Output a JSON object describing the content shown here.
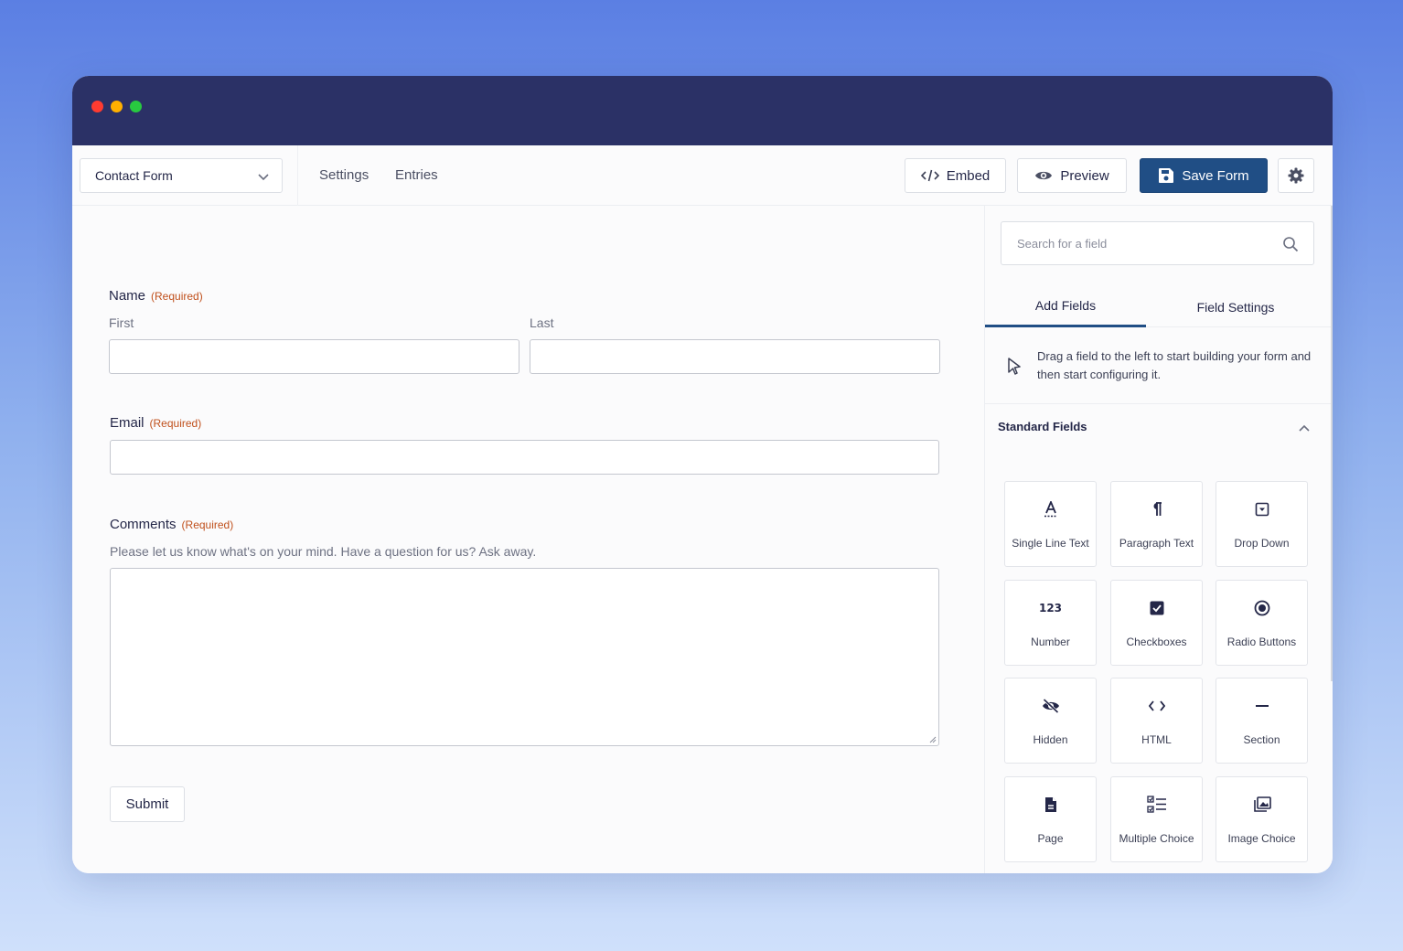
{
  "toolbar": {
    "form_name": "Contact Form",
    "nav": [
      "Settings",
      "Entries"
    ],
    "embed_label": "Embed",
    "preview_label": "Preview",
    "save_label": "Save Form"
  },
  "form": {
    "name": {
      "label": "Name",
      "required": "(Required)",
      "first": "First",
      "last": "Last"
    },
    "email": {
      "label": "Email",
      "required": "(Required)"
    },
    "comments": {
      "label": "Comments",
      "required": "(Required)",
      "description": "Please let us know what's on your mind. Have a question for us? Ask away."
    },
    "submit": "Submit"
  },
  "sidebar": {
    "search_placeholder": "Search for a field",
    "tabs": [
      "Add Fields",
      "Field Settings"
    ],
    "hint": "Drag a field to the left to start building your form and then start configuring it.",
    "section_title": "Standard Fields",
    "fields": [
      {
        "label": "Single Line Text",
        "icon": "single-line-text-icon"
      },
      {
        "label": "Paragraph Text",
        "icon": "paragraph-icon"
      },
      {
        "label": "Drop Down",
        "icon": "dropdown-icon"
      },
      {
        "label": "Number",
        "icon": "number-icon"
      },
      {
        "label": "Checkboxes",
        "icon": "checkbox-icon"
      },
      {
        "label": "Radio Buttons",
        "icon": "radio-icon"
      },
      {
        "label": "Hidden",
        "icon": "eye-slash-icon"
      },
      {
        "label": "HTML",
        "icon": "code-icon"
      },
      {
        "label": "Section",
        "icon": "minus-icon"
      },
      {
        "label": "Page",
        "icon": "file-icon"
      },
      {
        "label": "Multiple Choice",
        "icon": "list-check-icon"
      },
      {
        "label": "Image Choice",
        "icon": "images-icon"
      }
    ]
  },
  "colors": {
    "titlebar": "#2b3166",
    "primary": "#204e85",
    "required": "#c0501c"
  }
}
